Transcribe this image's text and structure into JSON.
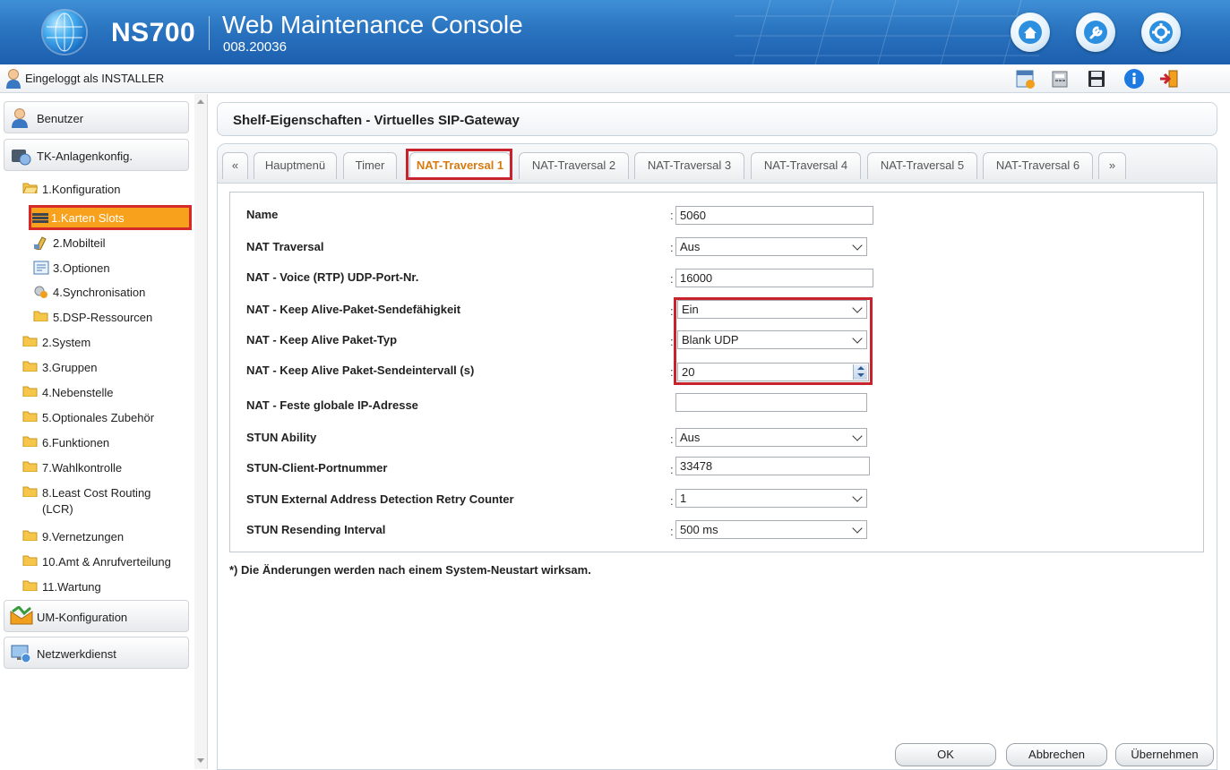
{
  "header": {
    "brand": "NS700",
    "title": "Web Maintenance Console",
    "version": "008.20036",
    "colors": {
      "header_blue": "#2a74c0",
      "accent_orange": "#f7a11c",
      "highlight_red": "#c8232c",
      "active_tab_text": "#d77a0f"
    },
    "buttons": [
      {
        "icon": "home-icon"
      },
      {
        "icon": "wrench-icon"
      },
      {
        "icon": "gear-icon"
      }
    ]
  },
  "loginbar": {
    "text": "Eingeloggt als INSTALLER",
    "tools": [
      "calendar-icon",
      "phone-system-icon",
      "save-disk-icon",
      "info-icon",
      "logout-icon"
    ]
  },
  "sidebar": {
    "sections": [
      {
        "label": "Benutzer",
        "icon": "user-icon"
      },
      {
        "label": "TK-Anlagenkonfig.",
        "icon": "pbx-config-icon"
      }
    ],
    "tree": [
      {
        "label": "1.Konfiguration",
        "icon": "folder-open-icon",
        "level": 0
      },
      {
        "label": "1.Karten Slots",
        "icon": "card-slots-icon",
        "level": 1,
        "selected": true
      },
      {
        "label": "2.Mobilteil",
        "icon": "handset-icon",
        "level": 1
      },
      {
        "label": "3.Optionen",
        "icon": "options-icon",
        "level": 1
      },
      {
        "label": "4.Synchronisation",
        "icon": "sync-icon",
        "level": 1
      },
      {
        "label": "5.DSP-Ressourcen",
        "icon": "folder-icon",
        "level": 1
      },
      {
        "label": "2.System",
        "icon": "folder-icon",
        "level": 0
      },
      {
        "label": "3.Gruppen",
        "icon": "folder-icon",
        "level": 0
      },
      {
        "label": "4.Nebenstelle",
        "icon": "folder-icon",
        "level": 0
      },
      {
        "label": "5.Optionales Zubehör",
        "icon": "folder-icon",
        "level": 0
      },
      {
        "label": "6.Funktionen",
        "icon": "folder-icon",
        "level": 0
      },
      {
        "label": "7.Wahlkontrolle",
        "icon": "folder-icon",
        "level": 0
      },
      {
        "label": "8.Least Cost Routing",
        "label2": "(LCR)",
        "icon": "folder-icon",
        "level": 0
      },
      {
        "label": "9.Vernetzungen",
        "icon": "folder-icon",
        "level": 0
      },
      {
        "label": "10.Amt & Anrufverteilung",
        "icon": "folder-icon",
        "level": 0
      },
      {
        "label": "11.Wartung",
        "icon": "folder-icon",
        "level": 0
      }
    ],
    "bottom_sections": [
      {
        "label": "UM-Konfiguration",
        "icon": "um-config-icon"
      },
      {
        "label": "Netzwerkdienst",
        "icon": "network-service-icon"
      }
    ]
  },
  "main": {
    "page_title": "Shelf-Eigenschaften - Virtuelles SIP-Gateway",
    "tabs": [
      {
        "label": "«"
      },
      {
        "label": "Hauptmenü"
      },
      {
        "label": "Timer"
      },
      {
        "label": "NAT-Traversal 1",
        "active": true
      },
      {
        "label": "NAT-Traversal 2"
      },
      {
        "label": "NAT-Traversal 3"
      },
      {
        "label": "NAT-Traversal 4"
      },
      {
        "label": "NAT-Traversal 5"
      },
      {
        "label": "NAT-Traversal 6"
      },
      {
        "label": "»"
      }
    ],
    "fields": [
      {
        "label": "Name",
        "type": "text",
        "value": "5060"
      },
      {
        "label": "NAT Traversal",
        "type": "select",
        "value": "Aus"
      },
      {
        "label": "NAT - Voice (RTP) UDP-Port-Nr.",
        "type": "text",
        "value": "16000"
      },
      {
        "label": "NAT - Keep Alive-Paket-Sendefähigkeit",
        "type": "select",
        "value": "Ein"
      },
      {
        "label": "NAT - Keep Alive Paket-Typ",
        "type": "select",
        "value": "Blank UDP"
      },
      {
        "label": "NAT - Keep Alive Paket-Sendeintervall (s)",
        "type": "spinner",
        "value": "20"
      },
      {
        "label": "NAT - Feste globale IP-Adresse",
        "type": "text",
        "value": ""
      },
      {
        "label": "STUN Ability",
        "type": "select",
        "value": "Aus"
      },
      {
        "label": "STUN-Client-Portnummer",
        "type": "text",
        "value": "33478"
      },
      {
        "label": "STUN External Address Detection Retry Counter",
        "type": "select",
        "value": "1"
      },
      {
        "label": "STUN Resending Interval",
        "type": "select",
        "value": "500 ms"
      }
    ],
    "colon": ":",
    "note": "*) Die Änderungen werden nach einem System-Neustart wirksam.",
    "buttons": {
      "ok": "OK",
      "cancel": "Abbrechen",
      "apply": "Übernehmen"
    }
  }
}
